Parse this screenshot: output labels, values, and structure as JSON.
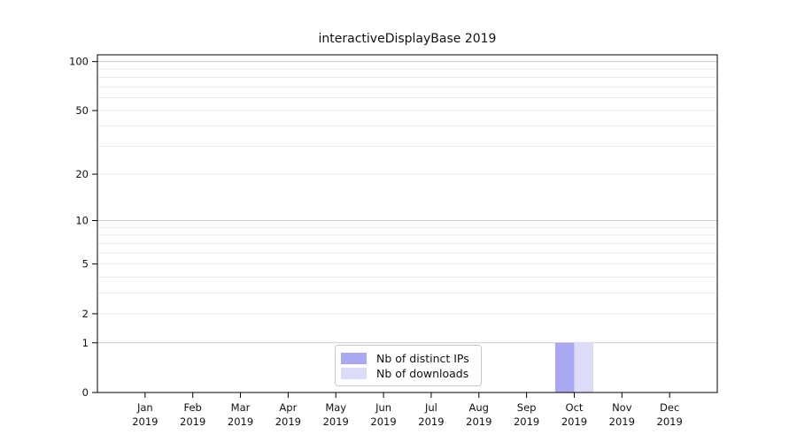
{
  "title": "interactiveDisplayBase 2019",
  "chart_data": {
    "type": "bar",
    "title": "interactiveDisplayBase 2019",
    "categories": [
      "Jan",
      "Feb",
      "Mar",
      "Apr",
      "May",
      "Jun",
      "Jul",
      "Aug",
      "Sep",
      "Oct",
      "Nov",
      "Dec"
    ],
    "year_label": "2019",
    "series": [
      {
        "name": "Nb of distinct IPs",
        "color": "#a9a9f2",
        "values": [
          0,
          0,
          0,
          0,
          0,
          0,
          0,
          0,
          0,
          1,
          0,
          0
        ]
      },
      {
        "name": "Nb of downloads",
        "color": "#dcdcf8",
        "values": [
          0,
          0,
          0,
          0,
          0,
          0,
          0,
          0,
          0,
          1,
          0,
          0
        ]
      }
    ],
    "yscale": "log1p",
    "yticks": [
      0,
      1,
      2,
      5,
      10,
      20,
      50,
      100
    ],
    "ylim": [
      0,
      110
    ],
    "grid": "on",
    "legend_position": "bottom-center",
    "colors": {
      "axis": "#000000",
      "grid_major": "#cccccc",
      "grid_minor": "#ebebeb",
      "text": "#111111"
    }
  }
}
